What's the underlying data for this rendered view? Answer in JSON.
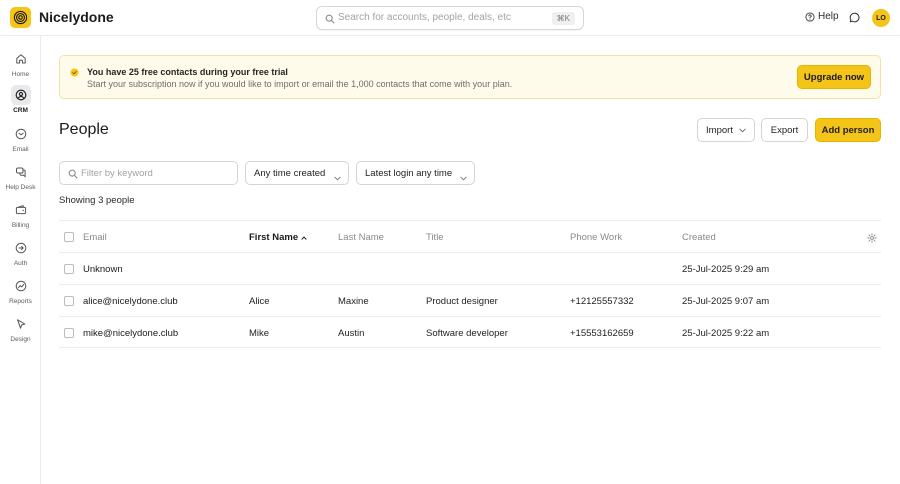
{
  "app": {
    "brand": "Nicelydone",
    "logo_icon": "spiral-logo-icon",
    "accent": "#f5c418"
  },
  "topbar": {
    "search_placeholder": "Search for accounts, people, deals, etc",
    "search_shortcut": "⌘K",
    "help_label": "Help",
    "avatar_initials": "LO"
  },
  "sidebar": {
    "items": [
      {
        "label": "Home",
        "icon": "home-icon"
      },
      {
        "label": "CRM",
        "icon": "crm-icon",
        "active": true
      },
      {
        "label": "Email",
        "icon": "email-icon"
      },
      {
        "label": "Help Desk",
        "icon": "help-desk-icon"
      },
      {
        "label": "Billing",
        "icon": "billing-icon"
      },
      {
        "label": "Auth",
        "icon": "auth-icon"
      },
      {
        "label": "Reports",
        "icon": "reports-icon"
      },
      {
        "label": "Design",
        "icon": "design-icon"
      }
    ]
  },
  "banner": {
    "title": "You have 25 free contacts during your free trial",
    "text": "Start your subscription now if you would like to import or email the 1,000 contacts that come with your plan.",
    "button": "Upgrade now"
  },
  "page": {
    "title": "People",
    "import_label": "Import",
    "export_label": "Export",
    "add_label": "Add person"
  },
  "filters": {
    "keyword_placeholder": "Filter by keyword",
    "created_value": "Any time created",
    "login_value": "Latest login any time"
  },
  "showing": "Showing 3 people",
  "table": {
    "columns": [
      "Email",
      "First Name",
      "Last Name",
      "Title",
      "Phone Work",
      "Created"
    ],
    "sorted_column": "First Name",
    "rows": [
      {
        "email": "Unknown",
        "first": "",
        "last": "",
        "title": "",
        "phone": "",
        "created": "25-Jul-2025 9:29 am"
      },
      {
        "email": "alice@nicelydone.club",
        "first": "Alice",
        "last": "Maxine",
        "title": "Product designer",
        "phone": "+12125557332",
        "created": "25-Jul-2025 9:07 am"
      },
      {
        "email": "mike@nicelydone.club",
        "first": "Mike",
        "last": "Austin",
        "title": "Software developer",
        "phone": "+15553162659",
        "created": "25-Jul-2025 9:22 am"
      }
    ]
  }
}
